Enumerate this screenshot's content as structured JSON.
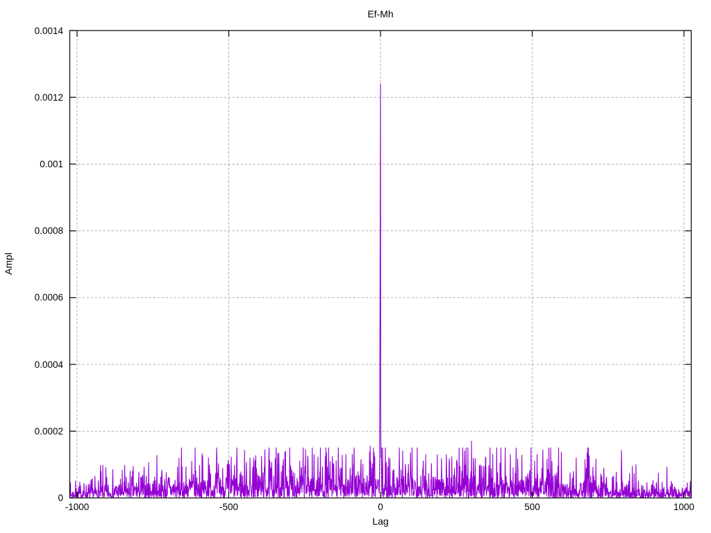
{
  "chart_data": {
    "type": "line",
    "title": "Ef-Mh",
    "xlabel": "Lag",
    "ylabel": "Ampl",
    "xlim": [
      -1024,
      1024
    ],
    "ylim": [
      0,
      0.0014
    ],
    "xticks": [
      -1000,
      -500,
      0,
      500,
      1000
    ],
    "xtick_labels": [
      "-1000",
      "-500",
      "0",
      "500",
      "1000"
    ],
    "yticks": [
      0,
      0.0002,
      0.0004,
      0.0006,
      0.0008,
      0.001,
      0.0012,
      0.0014
    ],
    "ytick_labels": [
      "0",
      "0.0002",
      "0.0004",
      "0.0006",
      "0.0008",
      "0.001",
      "0.0012",
      "0.0014"
    ],
    "grid": true,
    "grid_style": "dashed",
    "legend": "none",
    "line_color": "#9400d3",
    "frame_color": "#000000",
    "grid_color": "#a8a8a8",
    "background_color": "#ffffff",
    "series_name": "Ef-Mh",
    "lag_step": 1,
    "center_peak": [
      [
        -3,
        0.0001
      ],
      [
        -2,
        0.00044
      ],
      [
        -1,
        0.00083
      ],
      [
        0,
        0.00124
      ],
      [
        1,
        0.00019
      ],
      [
        2,
        0.00012
      ]
    ],
    "notable_spikes": [
      [
        -622,
        0.00011
      ],
      [
        -567,
        0.00012
      ],
      [
        -498,
        0.0001
      ],
      [
        -418,
        0.00012
      ],
      [
        -313,
        0.00014
      ],
      [
        -247,
        0.000145
      ],
      [
        -219,
        0.00013
      ],
      [
        -178,
        0.000135
      ],
      [
        -114,
        0.00013
      ],
      [
        -64,
        0.000115
      ],
      [
        -34,
        0.000155
      ],
      [
        27,
        0.00012
      ],
      [
        62,
        0.00015
      ],
      [
        121,
        0.00015
      ],
      [
        149,
        0.00013
      ],
      [
        187,
        0.00013
      ],
      [
        300,
        0.00017
      ],
      [
        347,
        0.00012
      ],
      [
        428,
        0.00013
      ],
      [
        508,
        0.00011
      ],
      [
        565,
        0.00011
      ],
      [
        645,
        0.00012
      ],
      [
        736,
        9e-05
      ]
    ],
    "noise_envelope": [
      [
        -1024,
        1.2e-05
      ],
      [
        -900,
        2e-05
      ],
      [
        -750,
        2.8e-05
      ],
      [
        -600,
        3.5e-05
      ],
      [
        -450,
        4e-05
      ],
      [
        -300,
        4.5e-05
      ],
      [
        -150,
        4.2e-05
      ],
      [
        0,
        4e-05
      ],
      [
        150,
        4.2e-05
      ],
      [
        300,
        4.6e-05
      ],
      [
        450,
        4e-05
      ],
      [
        600,
        3.5e-05
      ],
      [
        750,
        2.6e-05
      ],
      [
        900,
        1.8e-05
      ],
      [
        1024,
        1.2e-05
      ]
    ],
    "noise_cap": 0.00015,
    "noise_seed": 7
  }
}
